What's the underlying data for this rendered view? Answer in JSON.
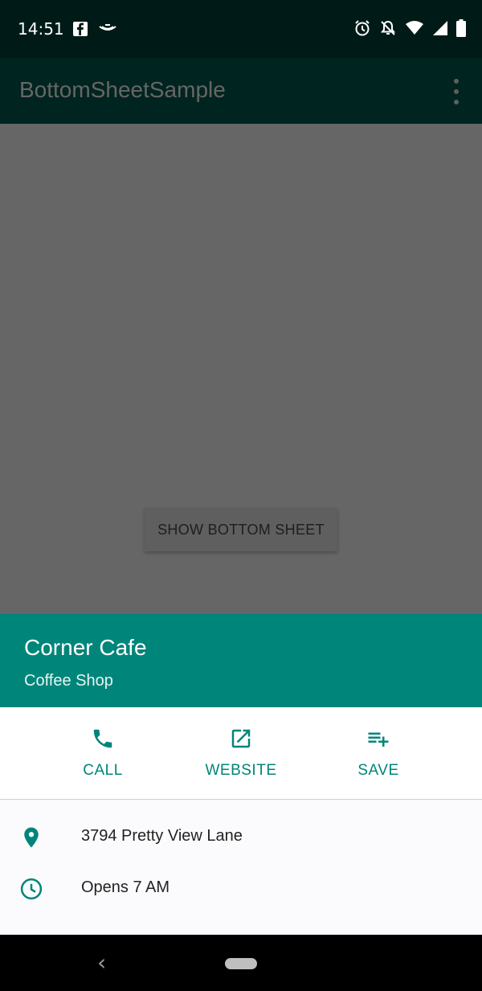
{
  "status_bar": {
    "time": "14:51",
    "left_icons": [
      "facebook-icon",
      "lamp-icon"
    ],
    "right_icons": [
      "alarm-icon",
      "notifications-off-icon",
      "wifi-icon",
      "signal-icon",
      "battery-icon"
    ]
  },
  "app_bar": {
    "title": "BottomSheetSample",
    "overflow_icon": "more-vert-icon"
  },
  "main": {
    "show_bottom_sheet_label": "SHOW BOTTOM SHEET"
  },
  "bottom_sheet": {
    "header": {
      "name": "Corner Cafe",
      "category": "Coffee Shop"
    },
    "actions": [
      {
        "label": "CALL",
        "icon": "phone-icon"
      },
      {
        "label": "WEBSITE",
        "icon": "open-in-new-icon"
      },
      {
        "label": "SAVE",
        "icon": "playlist-add-icon"
      }
    ],
    "details": [
      {
        "icon": "location-pin-icon",
        "text": "3794 Pretty View Lane"
      },
      {
        "icon": "clock-icon",
        "text": "Opens 7 AM"
      }
    ]
  },
  "nav_bar": {
    "back_icon": "back-icon",
    "home_icon": "home-pill-icon"
  },
  "colors": {
    "accent": "#00857a",
    "status_bar_bg": "#001b17",
    "app_bar_bg": "#00241f",
    "scrim": "#666666"
  }
}
